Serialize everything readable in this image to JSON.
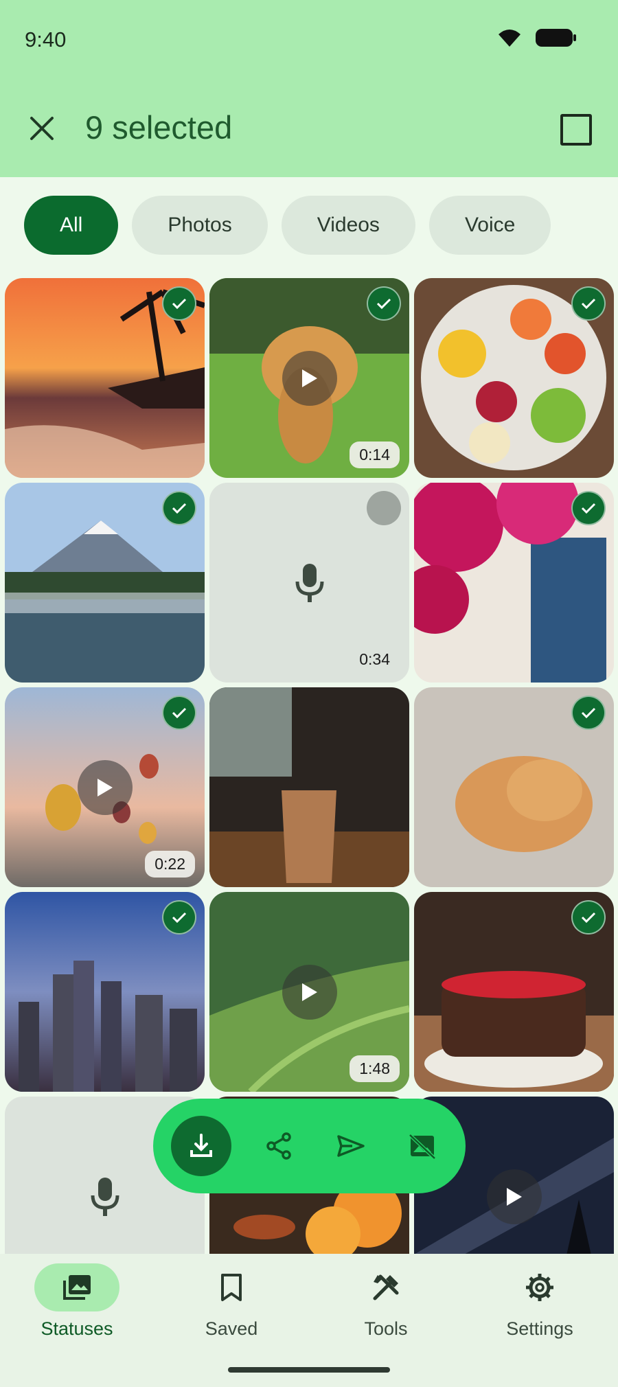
{
  "status_bar": {
    "time": "9:40"
  },
  "header": {
    "title": "9 selected"
  },
  "filters": [
    {
      "label": "All",
      "active": true
    },
    {
      "label": "Photos",
      "active": false
    },
    {
      "label": "Videos",
      "active": false
    },
    {
      "label": "Voice",
      "active": false
    }
  ],
  "grid": {
    "tiles": [
      {
        "kind": "photo",
        "subject": "sunset beach with palm trees",
        "selected": true
      },
      {
        "kind": "video",
        "subject": "golden retriever puppy running",
        "selected": true,
        "duration": "0:14"
      },
      {
        "kind": "photo",
        "subject": "bowl of fruit",
        "selected": true
      },
      {
        "kind": "photo",
        "subject": "mountain lake with mist",
        "selected": true
      },
      {
        "kind": "voice",
        "selected": false,
        "duration": "0:34"
      },
      {
        "kind": "photo",
        "subject": "pink flowers over blue door",
        "selected": true
      },
      {
        "kind": "video",
        "subject": "hot air balloons",
        "selected": true,
        "duration": "0:22"
      },
      {
        "kind": "photo",
        "subject": "iced coffee by window",
        "selected": false
      },
      {
        "kind": "photo",
        "subject": "sleeping orange kitten",
        "selected": true
      },
      {
        "kind": "photo",
        "subject": "city skyline at dusk",
        "selected": true
      },
      {
        "kind": "video",
        "subject": "rice terraces",
        "selected": false,
        "duration": "1:48"
      },
      {
        "kind": "photo",
        "subject": "birthday cake with candles",
        "selected": true
      },
      {
        "kind": "voice",
        "selected": false
      },
      {
        "kind": "photo",
        "subject": "diyas and marigolds",
        "selected": false
      },
      {
        "kind": "video",
        "subject": "milky way night sky",
        "selected": false
      }
    ]
  },
  "actions": [
    {
      "name": "download",
      "icon": "download-icon"
    },
    {
      "name": "share",
      "icon": "share-icon"
    },
    {
      "name": "send",
      "icon": "send-icon"
    },
    {
      "name": "hide",
      "icon": "hide-image-icon"
    }
  ],
  "nav": [
    {
      "label": "Statuses",
      "icon": "statuses-icon",
      "active": true
    },
    {
      "label": "Saved",
      "icon": "bookmark-icon",
      "active": false
    },
    {
      "label": "Tools",
      "icon": "tools-icon",
      "active": false
    },
    {
      "label": "Settings",
      "icon": "gear-icon",
      "active": false
    }
  ],
  "colors": {
    "header_bg": "#A9EBAF",
    "accent_dark": "#0B6B2E",
    "action_bar": "#25D366",
    "page_bg": "#EEF9EC"
  }
}
